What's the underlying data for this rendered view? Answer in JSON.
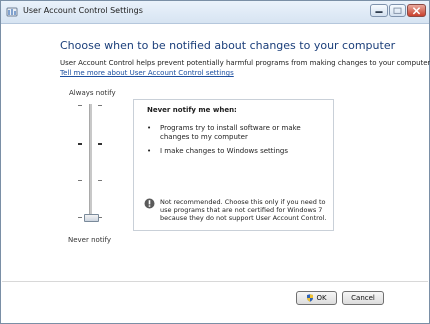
{
  "window": {
    "title": "User Account Control Settings"
  },
  "main": {
    "heading": "Choose when to be notified about changes to your computer",
    "description": "User Account Control helps prevent potentially harmful programs from making changes to your computer.",
    "learn_more_link": "Tell me more about User Account Control settings"
  },
  "slider": {
    "top_label": "Always notify",
    "bottom_label": "Never notify",
    "selected_level": "Never notify",
    "level_count": 4,
    "selected_index_from_top": 3
  },
  "panel": {
    "title": "Never notify me when:",
    "bullets": [
      "Programs try to install software or make changes to my computer",
      "I make changes to Windows settings"
    ],
    "warning": "Not recommended. Choose this only if you need to use programs that are not certified for Windows 7 because they do not support User Account Control."
  },
  "buttons": {
    "ok": "OK",
    "cancel": "Cancel"
  },
  "icons": {
    "window": "uac-settings-icon",
    "warning": "info-warning-icon",
    "ok_shield": "shield-icon"
  }
}
